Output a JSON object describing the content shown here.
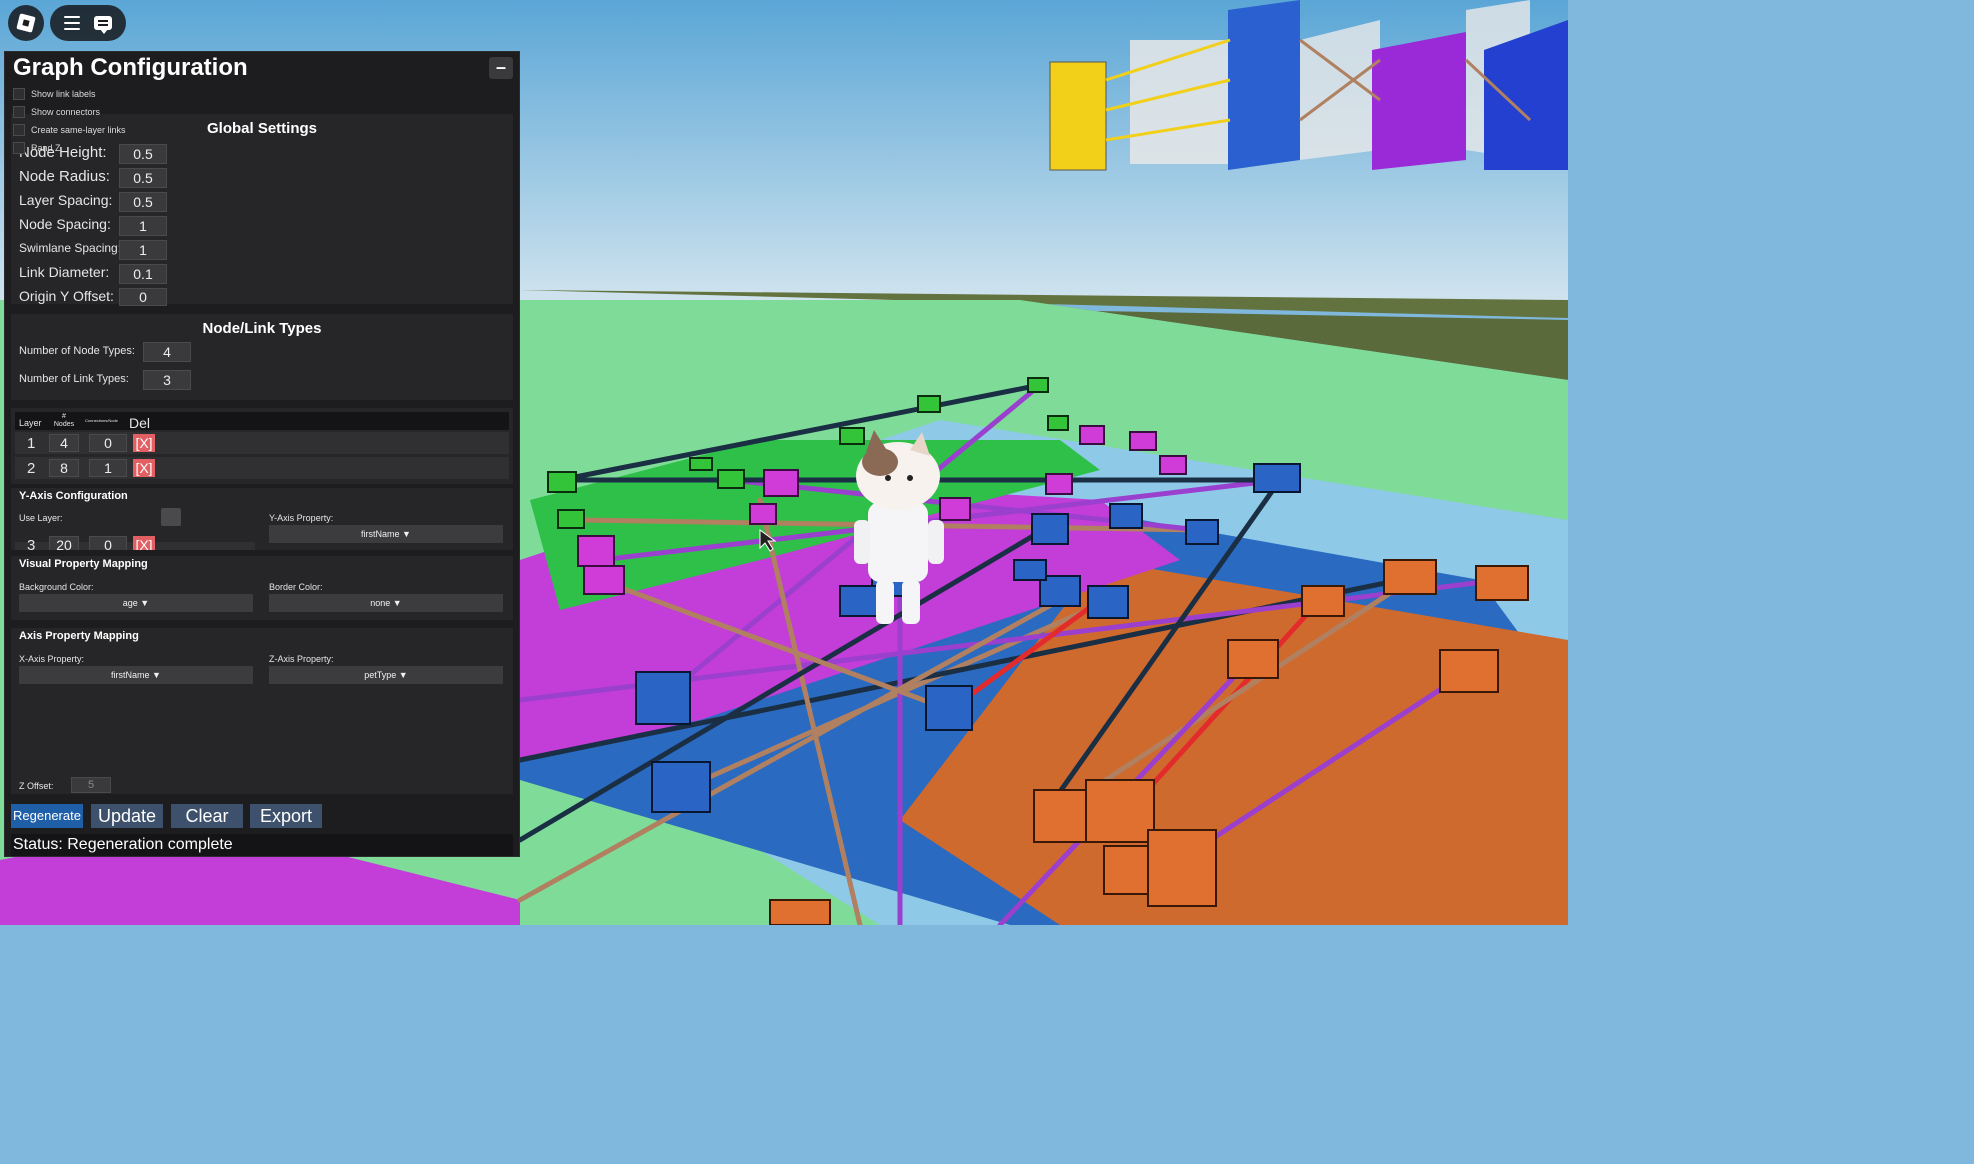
{
  "panel": {
    "title": "Graph Configuration",
    "minimize_label": "–",
    "checkboxes": {
      "show_link_labels": "Show link labels",
      "show_connectors": "Show connectors",
      "same_layer_links": "Create same-layer links",
      "rand_z": "Rand Z"
    },
    "global": {
      "title": "Global Settings",
      "node_height_label": "Node Height:",
      "node_height": "0.5",
      "node_radius_label": "Node Radius:",
      "node_radius": "0.5",
      "layer_spacing_label": "Layer Spacing:",
      "layer_spacing": "0.5",
      "node_spacing_label": "Node Spacing:",
      "node_spacing": "1",
      "swimlane_spacing_label": "Swimlane Spacing:",
      "swimlane_spacing": "1",
      "link_diameter_label": "Link Diameter:",
      "link_diameter": "0.1",
      "origin_y_label": "Origin Y Offset:",
      "origin_y": "0"
    },
    "types": {
      "title": "Node/Link Types",
      "node_types_label": "Number of Node Types:",
      "node_types": "4",
      "link_types_label": "Number of Link Types:",
      "link_types": "3"
    },
    "layers": {
      "headers": {
        "layer": "Layer",
        "nodes": "# Nodes",
        "conn": "Connections/Node",
        "del": "Del"
      },
      "rows": [
        {
          "layer": "1",
          "nodes": "4",
          "conn": "0",
          "del": "[X]"
        },
        {
          "layer": "2",
          "nodes": "8",
          "conn": "1",
          "del": "[X]"
        },
        {
          "layer": "3",
          "nodes": "20",
          "conn": "0",
          "del": "[X]"
        }
      ]
    },
    "yaxis": {
      "title": "Y-Axis Configuration",
      "use_layer_label": "Use Layer:",
      "property_label": "Y-Axis Property:",
      "property_value": "firstName ▼"
    },
    "visual": {
      "title": "Visual Property Mapping",
      "bg_label": "Background Color:",
      "bg_value": "age ▼",
      "border_label": "Border Color:",
      "border_value": "none ▼"
    },
    "axis": {
      "title": "Axis Property Mapping",
      "x_label": "X-Axis Property:",
      "x_value": "firstName ▼",
      "z_label": "Z-Axis Property:",
      "z_value": "petType ▼"
    },
    "z_offset_label": "Z Offset:",
    "z_offset_value": "5",
    "buttons": {
      "regenerate": "Regenerate",
      "update": "Update",
      "clear": "Clear",
      "export": "Export"
    },
    "status": "Status: Regeneration complete"
  },
  "colors": {
    "panel_bg": "#1d1d1f",
    "section_bg": "#262628",
    "delete_red": "#e25f63",
    "button_blue": "#3d506c",
    "regenerate_blue": "#1f5fa8"
  }
}
